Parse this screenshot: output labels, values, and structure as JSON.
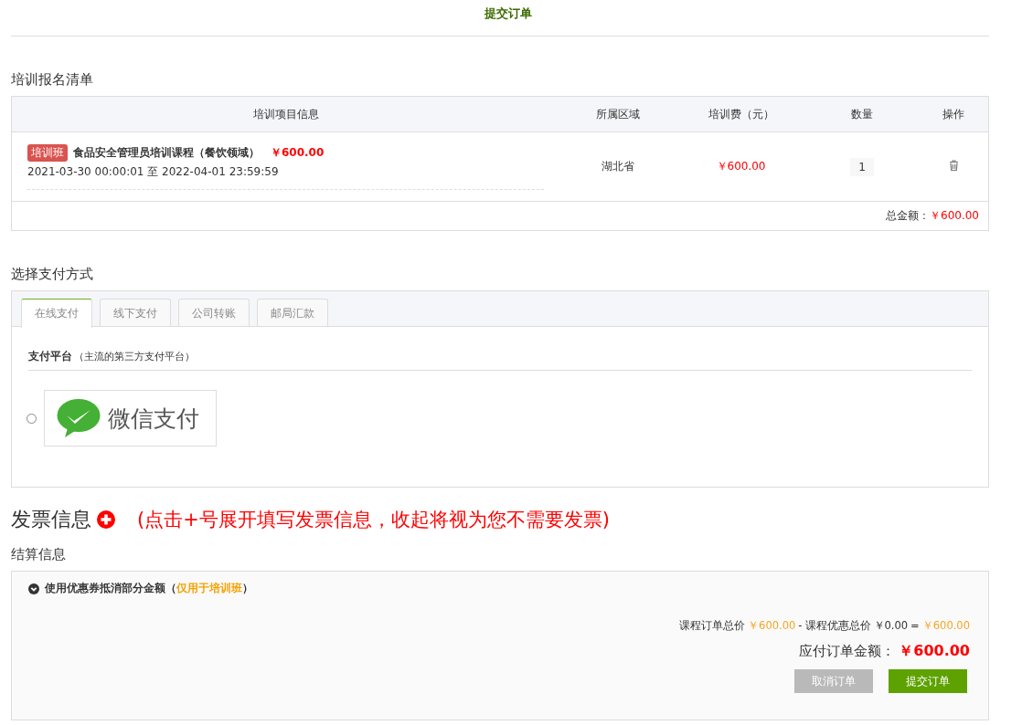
{
  "page_title": "提交订单",
  "enrollment": {
    "title": "培训报名清单",
    "columns": [
      "培训项目信息",
      "所属区域",
      "培训费（元）",
      "数量",
      "操作"
    ],
    "rows": [
      {
        "tag": "培训班",
        "name": "食品安全管理员培训课程（餐饮领域）",
        "price": "￥600.00",
        "period": "2021-03-30 00:00:01 至 2022-04-01 23:59:59",
        "region": "湖北省",
        "fee": "￥600.00",
        "quantity": "1"
      }
    ],
    "total_label": "总金额：",
    "total": "￥600.00"
  },
  "payment": {
    "title": "选择支付方式",
    "tabs": [
      {
        "label": "在线支付",
        "selected": true
      },
      {
        "label": "线下支付",
        "selected": false
      },
      {
        "label": "公司转账",
        "selected": false
      },
      {
        "label": "邮局汇款",
        "selected": false
      }
    ],
    "platform_label": "支付平台",
    "platform_note": "（主流的第三方支付平台）",
    "options": [
      {
        "label": "微信支付",
        "selected": false
      }
    ]
  },
  "invoice": {
    "title": "发票信息",
    "hint": "(点击+号展开填写发票信息，收起将视为您不需要发票)"
  },
  "settlement": {
    "title": "结算信息",
    "expanded": false,
    "coupon_prefix": "使用优惠券抵消部分金额（",
    "coupon_note": "仅用于培训班",
    "coupon_suffix": "）",
    "formula": [
      {
        "kind": "label",
        "text": "课程订单总价"
      },
      {
        "kind": "amount",
        "text": "￥600.00"
      },
      {
        "kind": "op",
        "text": "-"
      },
      {
        "kind": "label",
        "text": "课程优惠总价"
      },
      {
        "kind": "plain",
        "text": "￥0.00"
      },
      {
        "kind": "op",
        "text": "="
      },
      {
        "kind": "amount",
        "text": "￥600.00"
      }
    ],
    "payable_label": "应付订单金额：",
    "payable": "￥600.00",
    "buttons": [
      {
        "kind": "cancel",
        "label": "取消订单"
      },
      {
        "kind": "submit",
        "label": "提交订单"
      }
    ]
  }
}
